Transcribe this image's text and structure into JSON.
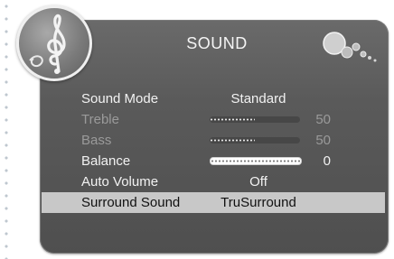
{
  "osd": {
    "title": "SOUND",
    "icon": "treble-clef-icon",
    "decoration": "bubbles-icon"
  },
  "menu": [
    {
      "label": "Sound Mode",
      "value": "Standard",
      "type": "text",
      "dim": false,
      "selected": false
    },
    {
      "label": "Treble",
      "value": "50",
      "level": 0.5,
      "type": "slider",
      "dim": true,
      "selected": false
    },
    {
      "label": "Bass",
      "value": "50",
      "level": 0.5,
      "type": "slider",
      "dim": true,
      "selected": false
    },
    {
      "label": "Balance",
      "value": "0",
      "level": 0.5,
      "type": "balance",
      "dim": false,
      "selected": false
    },
    {
      "label": "Auto Volume",
      "value": "Off",
      "type": "text",
      "dim": false,
      "selected": false
    },
    {
      "label": "Surround Sound",
      "value": "TruSurround",
      "type": "text",
      "dim": false,
      "selected": true
    }
  ],
  "colors": {
    "panel": "#5a5a5a",
    "highlight": "#c8c8c8",
    "text": "#f2f2f2",
    "dim_text": "#9a9a9a"
  }
}
